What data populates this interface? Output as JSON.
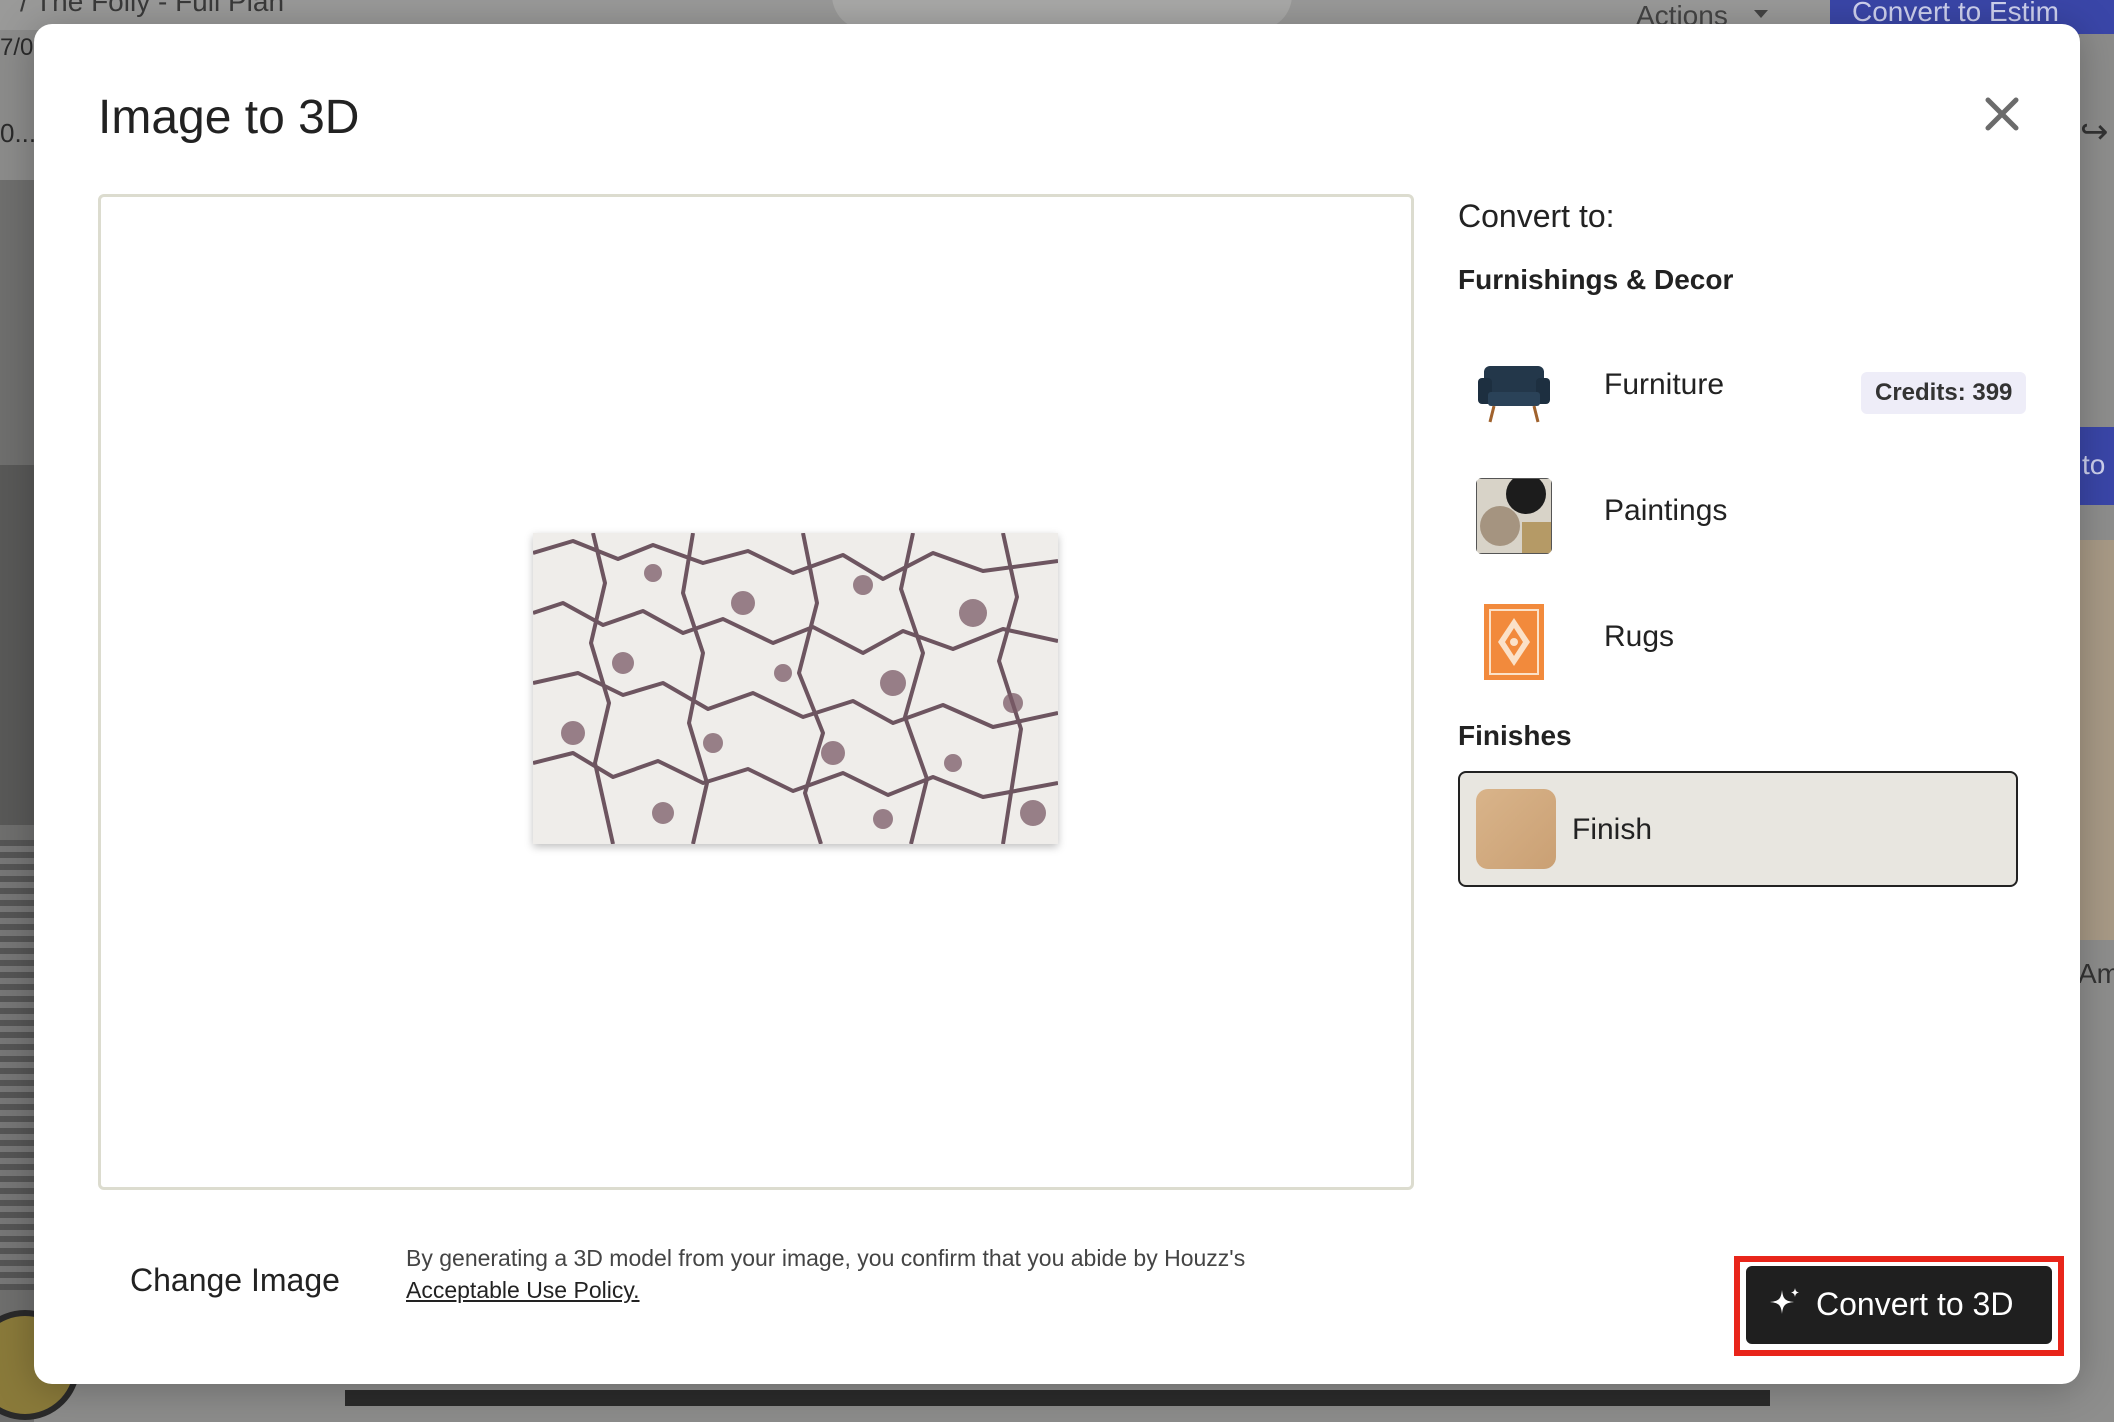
{
  "background": {
    "breadcrumb": "/ The Folly - Full Plan",
    "date_fragment": "7/0",
    "ellipsis": "0...",
    "actions_label": "Actions",
    "estimate_button": "Convert to Estim",
    "right_button_fragment": "to",
    "right_text_fragment": "Am"
  },
  "modal": {
    "title": "Image to 3D",
    "close_icon": "close-icon",
    "convert_to_heading": "Convert to:",
    "sections": {
      "furnishings_title": "Furnishings & Decor",
      "finishes_title": "Finishes"
    },
    "options": {
      "furniture": "Furniture",
      "paintings": "Paintings",
      "rugs": "Rugs",
      "finish": "Finish"
    },
    "credits_label": "Credits: 399",
    "change_image": "Change Image",
    "disclaimer_text": "By generating a 3D model from your image, you confirm that you abide by Houzz's",
    "policy_link": "Acceptable Use Policy.",
    "cta_label": "Convert to 3D",
    "cta_icon": "sparkle-icon"
  },
  "colors": {
    "cta_background": "#1f1f1f",
    "cta_highlight": "#e8251a",
    "credits_background": "#eeedf8",
    "finish_selected_background": "#e8e6e0"
  }
}
